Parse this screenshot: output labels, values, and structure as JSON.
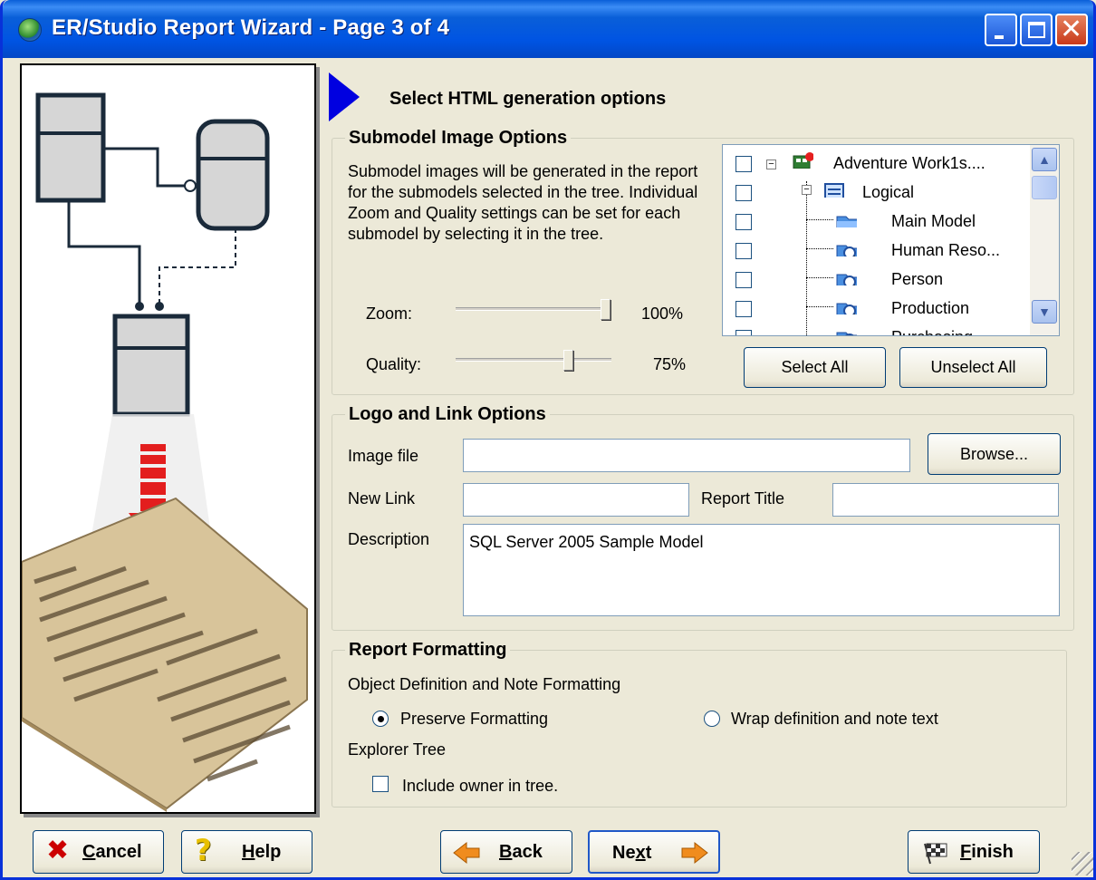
{
  "window": {
    "title": "ER/Studio Report Wizard - Page 3 of 4",
    "controls": {
      "minimize": "minimize-icon",
      "maximize": "maximize-icon",
      "close": "close-icon"
    }
  },
  "heading": "Select HTML generation options",
  "submodel_image_options": {
    "legend": "Submodel Image Options",
    "description": "Submodel images will be generated in the report for the submodels selected in the tree.  Individual Zoom and Quality settings can be set for each submodel  by selecting it in the tree.",
    "zoom": {
      "label": "Zoom:",
      "value_text": "100%",
      "value": 1.0
    },
    "quality": {
      "label": "Quality:",
      "value_text": "75%",
      "value": 0.75
    },
    "tree": {
      "items": [
        {
          "label": "Adventure Work1s....",
          "checked": false,
          "icon": "model-icon"
        },
        {
          "label": "Logical",
          "checked": false,
          "icon": "logical-model-icon"
        },
        {
          "label": "Main Model",
          "checked": false,
          "icon": "folder-icon"
        },
        {
          "label": "Human Reso...",
          "checked": false,
          "icon": "submodel-icon"
        },
        {
          "label": "Person",
          "checked": false,
          "icon": "submodel-icon"
        },
        {
          "label": "Production",
          "checked": false,
          "icon": "submodel-icon"
        },
        {
          "label": "Purchasing",
          "checked": false,
          "icon": "submodel-icon"
        }
      ]
    },
    "select_all": "Select All",
    "unselect_all": "Unselect All"
  },
  "logo_link_options": {
    "legend": "Logo and Link Options",
    "image_file_label": "Image file",
    "image_file_value": "",
    "browse": "Browse...",
    "new_link_label": "New Link",
    "new_link_value": "",
    "report_title_label": "Report Title",
    "report_title_value": "",
    "description_label": "Description",
    "description_value": "SQL Server 2005 Sample Model"
  },
  "report_formatting": {
    "legend": "Report Formatting",
    "object_definition_label": "Object Definition and Note Formatting",
    "preserve_formatting": "Preserve Formatting",
    "preserve_selected": true,
    "wrap_text": "Wrap definition and note text",
    "explorer_tree_label": "Explorer Tree",
    "include_owner": "Include owner in tree.",
    "include_owner_checked": false
  },
  "buttons": {
    "cancel_pre": "",
    "cancel_hot": "C",
    "cancel_rest": "ancel",
    "help_hot": "H",
    "help_rest": "elp",
    "back_hot": "B",
    "back_rest": "ack",
    "next_pre": "Ne",
    "next_hot": "x",
    "next_rest": "t",
    "finish_hot": "F",
    "finish_rest": "inish"
  },
  "colors": {
    "title_bar": "#0054e3",
    "accent_arrow": "#0000e0",
    "cancel_x": "#cc0000",
    "nav_arrow": "#f08c1e"
  }
}
